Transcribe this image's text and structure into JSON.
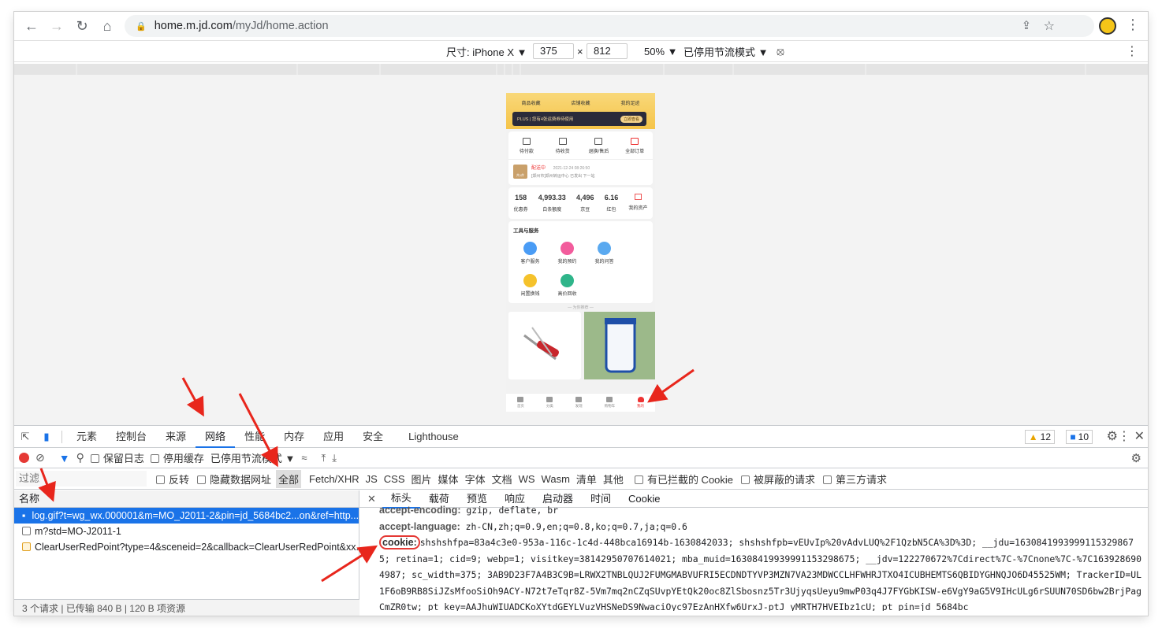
{
  "browser": {
    "url_host": "home.m.jd.com",
    "url_path": "/myJd/home.action"
  },
  "device": {
    "size_label": "尺寸: iPhone X",
    "width": "375",
    "times": "×",
    "height": "812",
    "zoom": "50%",
    "throttle": "已停用节流模式"
  },
  "phone": {
    "head_items": [
      "商品收藏",
      "店铺收藏",
      "我的足迹"
    ],
    "plus_text": "PLUS | 您有4张运费券待使用",
    "plus_btn": "立即查看",
    "orders": [
      "待付款",
      "待收货",
      "退换/售后",
      "全部订单"
    ],
    "ship_status": "配送中",
    "ship_time": "2021-12-24 08:26:50",
    "ship_detail": "[郑州市]郑州转运中心 已发出 下一站",
    "ship_box": "共1件",
    "assets": [
      {
        "value": "158",
        "label": "优惠券"
      },
      {
        "value": "4,993.33",
        "label": "白条额度"
      },
      {
        "value": "4,496",
        "label": "京豆"
      },
      {
        "value": "6.16",
        "label": "红包"
      },
      {
        "value": "",
        "label": "我的资产"
      }
    ],
    "tools_title": "工具与服务",
    "tools": [
      {
        "label": "客户服务",
        "color": "#4a9cf5"
      },
      {
        "label": "我的预约",
        "color": "#f25c9c"
      },
      {
        "label": "我的问答",
        "color": "#5aa9f0"
      },
      {
        "label": "闲置换钱",
        "color": "#f5c22b"
      },
      {
        "label": "高价回收",
        "color": "#2fb58a"
      }
    ],
    "recommend": "为你推荐",
    "tabbar": [
      "首页",
      "分类",
      "发现",
      "购物车",
      "我的"
    ]
  },
  "devtools": {
    "tabs": [
      "元素",
      "控制台",
      "来源",
      "网络",
      "性能",
      "内存",
      "应用",
      "安全",
      "Lighthouse"
    ],
    "active_tab": "网络",
    "warnings": "12",
    "messages": "10",
    "preserve_log": "保留日志",
    "disable_cache": "停用缓存",
    "throttle": "已停用节流模式",
    "filter_placeholder": "过滤",
    "invert": "反转",
    "hide_data_urls": "隐藏数据网址",
    "types": [
      "全部",
      "Fetch/XHR",
      "JS",
      "CSS",
      "图片",
      "媒体",
      "字体",
      "文档",
      "WS",
      "Wasm",
      "清单",
      "其他"
    ],
    "blocked_cookies": "有已拦截的 Cookie",
    "blocked_requests": "被屏蔽的请求",
    "third_party": "第三方请求",
    "name_header": "名称",
    "requests": [
      "log.gif?t=wg_wx.000001&m=MO_J2011-2&pin=jd_5684bc2...on&ref=http...",
      "m?std=MO-J2011-1",
      "ClearUserRedPoint?type=4&sceneid=2&callback=ClearUserRedPoint&xx..."
    ],
    "footer": "3 个请求  |  已传输 840 B  |  120 B 项资源",
    "detail_tabs": [
      "标头",
      "载荷",
      "预览",
      "响应",
      "启动器",
      "时间",
      "Cookie"
    ],
    "headers": [
      {
        "key": "accept-encoding:",
        "value": "gzip, deflate, br"
      },
      {
        "key": "accept-language:",
        "value": "zh-CN,zh;q=0.9,en;q=0.8,ko;q=0.7,ja;q=0.6"
      },
      {
        "key": "cookie:",
        "value": "shshshfpa=83a4c3e0-953a-116c-1c4d-448bca16914b-1630842033; shshshfpb=vEUvIp%20vAdvLUQ%2F1QzbN5CA%3D%3D; __jdu=16308419939991153298675; retina=1; cid=9; webp=1; visitkey=38142950707614021; mba_muid=16308419939991153298675; __jdv=122270672%7Cdirect%7C-%7Cnone%7C-%7C1639286904987; sc_width=375; 3AB9D23F7A4B3C9B=LRWX2TNBLQUJ2FUMGMABVUFRI5ECDNDTYVP3MZN7VA23MDWCCLHFWHRJTXO4ICUBHEMTS6QBIDYGHNQJO6D45525WM; TrackerID=UL1F6oB9RB8SiJZsMfooSiOh9ACY-N72t7eTqr8Z-5Vm7mq2nCZqSUvpYEtQk20oc8ZlSbosnz5Tr3UjyqsUeyu9mwP03q4J7FYGbKISW-e6VgY9aG5V9IHcULg6rSUUN70SD6bw2BrjPagCmZR0tw; pt_key=AAJhuWIUADCKoXYtdGEYLVuzVHSNeDS9NwaciOyc97EzAnHXfw6UrxJ-ptJ_yMRTH7HVEIbz1cU; pt_pin=jd_5684bc"
      }
    ]
  }
}
